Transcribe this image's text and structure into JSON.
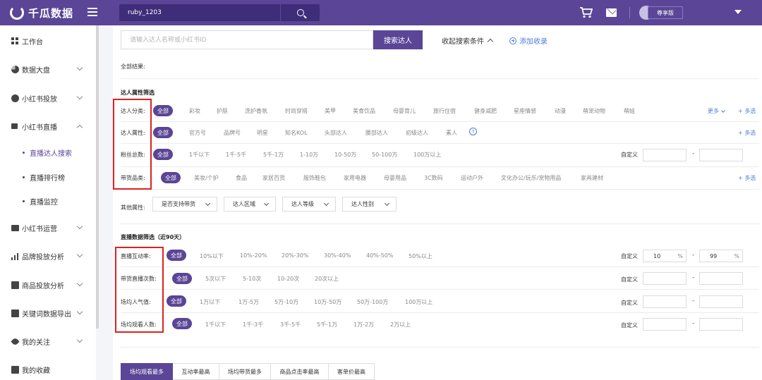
{
  "app": {
    "name": "千瓜数据"
  },
  "header": {
    "search_value": "ruby_1203",
    "plan_label": "尊享版"
  },
  "sidebar": {
    "items": [
      {
        "label": "工作台"
      },
      {
        "label": "数据大盘"
      },
      {
        "label": "小红书投放"
      },
      {
        "label": "小红书直播"
      },
      {
        "label": "小红书运营"
      },
      {
        "label": "品牌投放分析"
      },
      {
        "label": "商品投放分析"
      },
      {
        "label": "关键词数据导出"
      },
      {
        "label": "我的关注"
      },
      {
        "label": "我的收藏"
      }
    ],
    "sub_items": [
      {
        "label": "直播达人搜索"
      },
      {
        "label": "直播排行榜"
      },
      {
        "label": "直播监控"
      }
    ]
  },
  "search": {
    "placeholder": "请输入达人名称或小红书ID",
    "button": "搜索达人",
    "collapse": "收起搜索条件",
    "favorite": "添加收录"
  },
  "results_label": "全部结果:",
  "attr_section": {
    "title": "达人属性筛选",
    "category": {
      "label": "达人分类:",
      "all": "全部",
      "options": [
        "彩妆",
        "护肤",
        "洗护香氛",
        "时尚穿搭",
        "美甲",
        "美食饮品",
        "母婴育儿",
        "旅行住宿",
        "健身减肥",
        "星座情感",
        "动漫",
        "萌宠动物",
        "萌娃"
      ],
      "more": "更多",
      "multi": "+ 多选"
    },
    "attribute": {
      "label": "达人属性:",
      "all": "全部",
      "options": [
        "官方号",
        "品牌号",
        "明星",
        "知名KOL",
        "头部达人",
        "腰部达人",
        "初级达人",
        "素人"
      ],
      "help": "?",
      "multi": "+ 多选"
    },
    "fans": {
      "label": "粉丝总数:",
      "all": "全部",
      "options": [
        "1千以下",
        "1千-5千",
        "5千-1万",
        "1-10万",
        "10-50万",
        "50-100万",
        "100万以上"
      ],
      "custom": "自定义",
      "dash": "-"
    },
    "goods": {
      "label": "带货品类:",
      "all": "全部",
      "options": [
        "美妆/个护",
        "食品",
        "家居百货",
        "服饰鞋包",
        "家用电器",
        "母婴用品",
        "3C数码",
        "运动户外",
        "文化办公/玩乐/宠物用品",
        "家具建材"
      ],
      "multi": "+ 多选"
    },
    "other": {
      "label": "其他属性:",
      "dropdowns": [
        "是否支持带货",
        "达人区域",
        "达人等级",
        "达人性别"
      ]
    }
  },
  "live_section": {
    "title": "直播数据筛选（近90天）",
    "interaction": {
      "label": "直播互动率:",
      "all": "全部",
      "options": [
        "10%以下",
        "10%-20%",
        "20%-30%",
        "30%-40%",
        "40%-50%",
        "50%以上"
      ],
      "custom": "自定义",
      "min": "10",
      "max": "99",
      "unit": "%",
      "dash": "-"
    },
    "sessions": {
      "label": "带货直播次数:",
      "all": "全部",
      "options": [
        "5次以下",
        "5-10次",
        "10-20次",
        "20次以上"
      ],
      "custom": "自定义",
      "dash": "-"
    },
    "popularity": {
      "label": "场均人气值:",
      "all": "全部",
      "options": [
        "1万以下",
        "1万-5万",
        "5万-10万",
        "10万-50万",
        "50万-100万",
        "100万以上"
      ],
      "custom": "自定义",
      "dash": "-"
    },
    "viewers": {
      "label": "场均观看人数:",
      "all": "全部",
      "options": [
        "1千以下",
        "1千-3千",
        "3千-5千",
        "5千-1万",
        "1万-2万",
        "2万以上"
      ],
      "custom": "自定义",
      "dash": "-"
    }
  },
  "tabs": [
    {
      "label": "场均观看最多"
    },
    {
      "label": "互动率最高"
    },
    {
      "label": "场均带货最多"
    },
    {
      "label": "商品点击率最高"
    },
    {
      "label": "客单价最高"
    }
  ],
  "colors": {
    "brand": "#5a4596",
    "link": "#4a7ede",
    "highlight": "#e02020"
  }
}
